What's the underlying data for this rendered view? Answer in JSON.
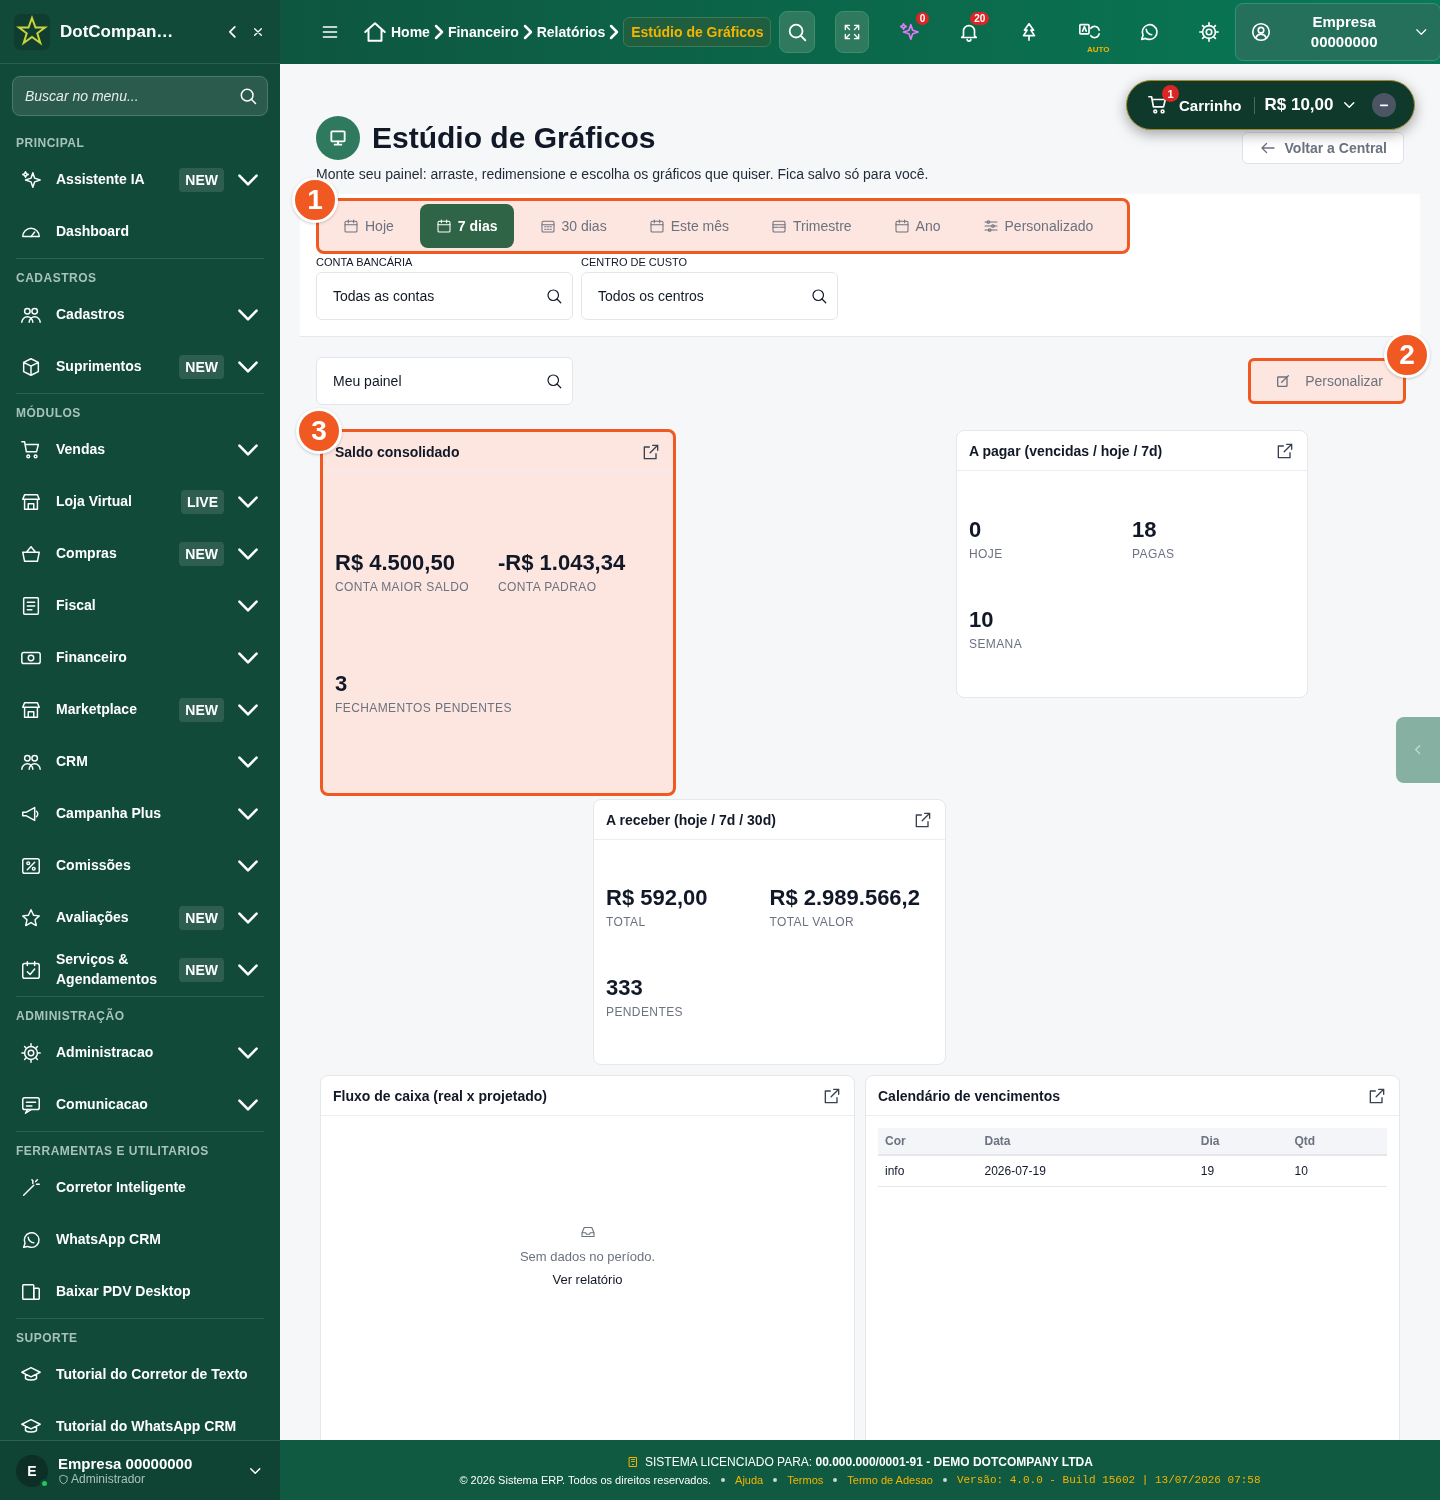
{
  "sidebar": {
    "brand": "DotCompan…",
    "search": {
      "placeholder": "Buscar no menu..."
    },
    "sections": [
      {
        "title": "PRINCIPAL",
        "items": [
          {
            "label": "Assistente IA",
            "badge": "NEW",
            "expandable": true
          },
          {
            "label": "Dashboard",
            "expandable": false
          }
        ]
      },
      {
        "title": "CADASTROS",
        "items": [
          {
            "label": "Cadastros",
            "expandable": true
          },
          {
            "label": "Suprimentos",
            "badge": "NEW",
            "expandable": true
          }
        ]
      },
      {
        "title": "MÓDULOS",
        "items": [
          {
            "label": "Vendas",
            "expandable": true
          },
          {
            "label": "Loja Virtual",
            "badge": "LIVE",
            "expandable": true
          },
          {
            "label": "Compras",
            "badge": "NEW",
            "expandable": true
          },
          {
            "label": "Fiscal",
            "expandable": true
          },
          {
            "label": "Financeiro",
            "expandable": true
          },
          {
            "label": "Marketplace",
            "badge": "NEW",
            "expandable": true
          },
          {
            "label": "CRM",
            "expandable": true
          },
          {
            "label": "Campanha Plus",
            "expandable": true
          },
          {
            "label": "Comissões",
            "expandable": true
          },
          {
            "label": "Avaliações",
            "badge": "NEW",
            "expandable": true
          },
          {
            "label": "Serviços & Agendamentos",
            "badge": "NEW",
            "expandable": true
          }
        ]
      },
      {
        "title": "ADMINISTRAÇÃO",
        "items": [
          {
            "label": "Administracao",
            "expandable": true
          },
          {
            "label": "Comunicacao",
            "expandable": true
          }
        ]
      },
      {
        "title": "FERRAMENTAS E UTILITARIOS",
        "items": [
          {
            "label": "Corretor Inteligente",
            "expandable": false
          },
          {
            "label": "WhatsApp CRM",
            "expandable": false
          },
          {
            "label": "Baixar PDV Desktop",
            "expandable": false
          }
        ]
      },
      {
        "title": "SUPORTE",
        "items": [
          {
            "label": "Tutorial do Corretor de Texto",
            "expandable": false
          },
          {
            "label": "Tutorial do WhatsApp CRM",
            "expandable": false
          }
        ]
      }
    ],
    "user": {
      "avatar": "E",
      "name": "Empresa 00000000",
      "role": "Administrador",
      "online": true
    }
  },
  "header": {
    "breadcrumb": [
      {
        "label": "Home",
        "current": false
      },
      {
        "label": "Financeiro",
        "current": false
      },
      {
        "label": "Relatórios",
        "current": false
      },
      {
        "label": "Estúdio de Gráficos",
        "current": true
      }
    ],
    "sparkle_badge": "0",
    "bell_badge": "20",
    "translate_label": "AUTO",
    "company": {
      "line_1": "Empresa",
      "line_2": "00000000"
    }
  },
  "cart": {
    "badge": "1",
    "label": "Carrinho",
    "total": "R$ 10,00"
  },
  "page": {
    "title": "Estúdio de Gráficos",
    "subtitle": "Monte seu painel: arraste, redimensione e escolha os gráficos que quiser. Fica salvo só para você.",
    "back_button": "Voltar a Central"
  },
  "periods": {
    "callout": "1",
    "tabs": [
      {
        "label": "Hoje",
        "selected": false
      },
      {
        "label": "7 dias",
        "selected": true
      },
      {
        "label": "30 dias",
        "selected": false
      },
      {
        "label": "Este mês",
        "selected": false
      },
      {
        "label": "Trimestre",
        "selected": false
      },
      {
        "label": "Ano",
        "selected": false
      },
      {
        "label": "Personalizado",
        "selected": false
      }
    ]
  },
  "filters": [
    {
      "label": "CONTA BANCÁRIA",
      "value": "Todas as contas"
    },
    {
      "label": "CENTRO DE CUSTO",
      "value": "Todos os centros"
    }
  ],
  "panel_select": {
    "value": "Meu painel"
  },
  "customize_button": {
    "label": "Personalizar",
    "callout": "2"
  },
  "widgets": [
    {
      "kind": "metrics",
      "title": "Saldo consolidado",
      "callout": "3",
      "metrics": [
        {
          "value": "R$ 4.500,50",
          "label": "CONTA MAIOR SALDO"
        },
        {
          "value": "-R$ 1.043,34",
          "label": "CONTA PADRAO"
        },
        {
          "value": "3",
          "label": "FECHAMENTOS PENDENTES"
        }
      ]
    },
    {
      "kind": "metrics",
      "title": "A pagar (vencidas / hoje / 7d)",
      "metrics": [
        {
          "value": "0",
          "label": "HOJE"
        },
        {
          "value": "18",
          "label": "PAGAS"
        },
        {
          "value": "10",
          "label": "SEMANA"
        }
      ]
    },
    {
      "kind": "metrics",
      "title": "A receber (hoje / 7d / 30d)",
      "metrics": [
        {
          "value": "R$ 592,00",
          "label": "TOTAL"
        },
        {
          "value": "R$ 2.989.566,2",
          "label": "TOTAL VALOR"
        },
        {
          "value": "333",
          "label": "PENDENTES"
        }
      ]
    },
    {
      "kind": "empty",
      "title": "Fluxo de caixa (real x projetado)",
      "message": "Sem dados no período.",
      "link": "Ver relatório"
    },
    {
      "kind": "table",
      "title": "Calendário de vencimentos",
      "columns": [
        "Cor",
        "Data",
        "Dia",
        "Qtd"
      ],
      "rows": [
        [
          "info",
          "2026-07-19",
          "19",
          "10"
        ]
      ]
    }
  ],
  "footer": {
    "license": "SISTEMA LICENCIADO PARA: **00.000.000/0001-91 - DEMO DOTCOMPANY LTDA**",
    "copyright": "© 2026 Sistema ERP. Todos os direitos reservados.",
    "links": [
      "Ajuda",
      "Termos",
      "Termo de Adesao"
    ],
    "version": "Versão: 4.0.0 - Build 15602 | 13/07/2026 07:58"
  }
}
